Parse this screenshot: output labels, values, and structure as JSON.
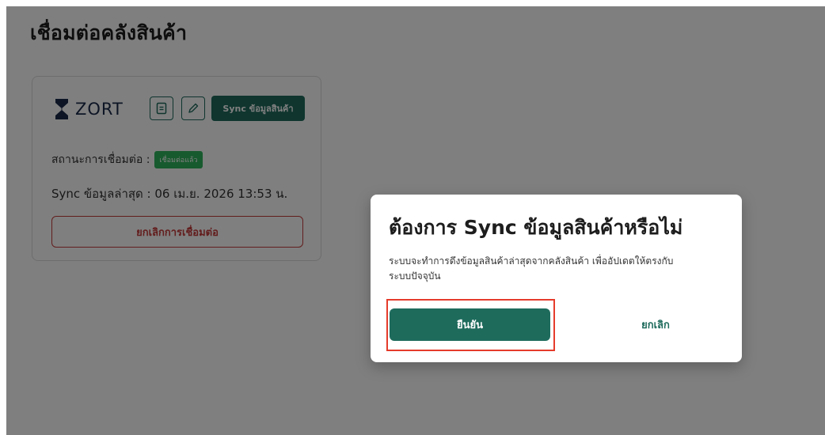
{
  "page": {
    "title": "เชื่อมต่อคลังสินค้า"
  },
  "card": {
    "logo_text": "ZORT",
    "doc_icon": "document-icon",
    "edit_icon": "pencil-icon",
    "sync_label": "Sync ข้อมูลสินค้า",
    "status_label": "สถานะการเชื่อมต่อ :",
    "status_badge": "เชื่อมต่อแล้ว",
    "last_sync": "Sync ข้อมูลล่าสุด : 06 เม.ย. 2026 13:53 น.",
    "disconnect_label": "ยกเลิกการเชื่อมต่อ"
  },
  "modal": {
    "title": "ต้องการ Sync ข้อมูลสินค้าหรือไม่",
    "description_line1": "ระบบจะทำการดึงข้อมูลสินค้าล่าสุดจากคลังสินค้า เพื่ออัปเดตให้ตรงกับ",
    "description_line2": "ระบบปัจจุบัน",
    "confirm_label": "ยืนยัน",
    "cancel_label": "ยกเลิก"
  },
  "colors": {
    "primary": "#1e6b5c",
    "danger": "#c73b3b",
    "success": "#2eb55c",
    "highlight": "#e53b2b"
  }
}
